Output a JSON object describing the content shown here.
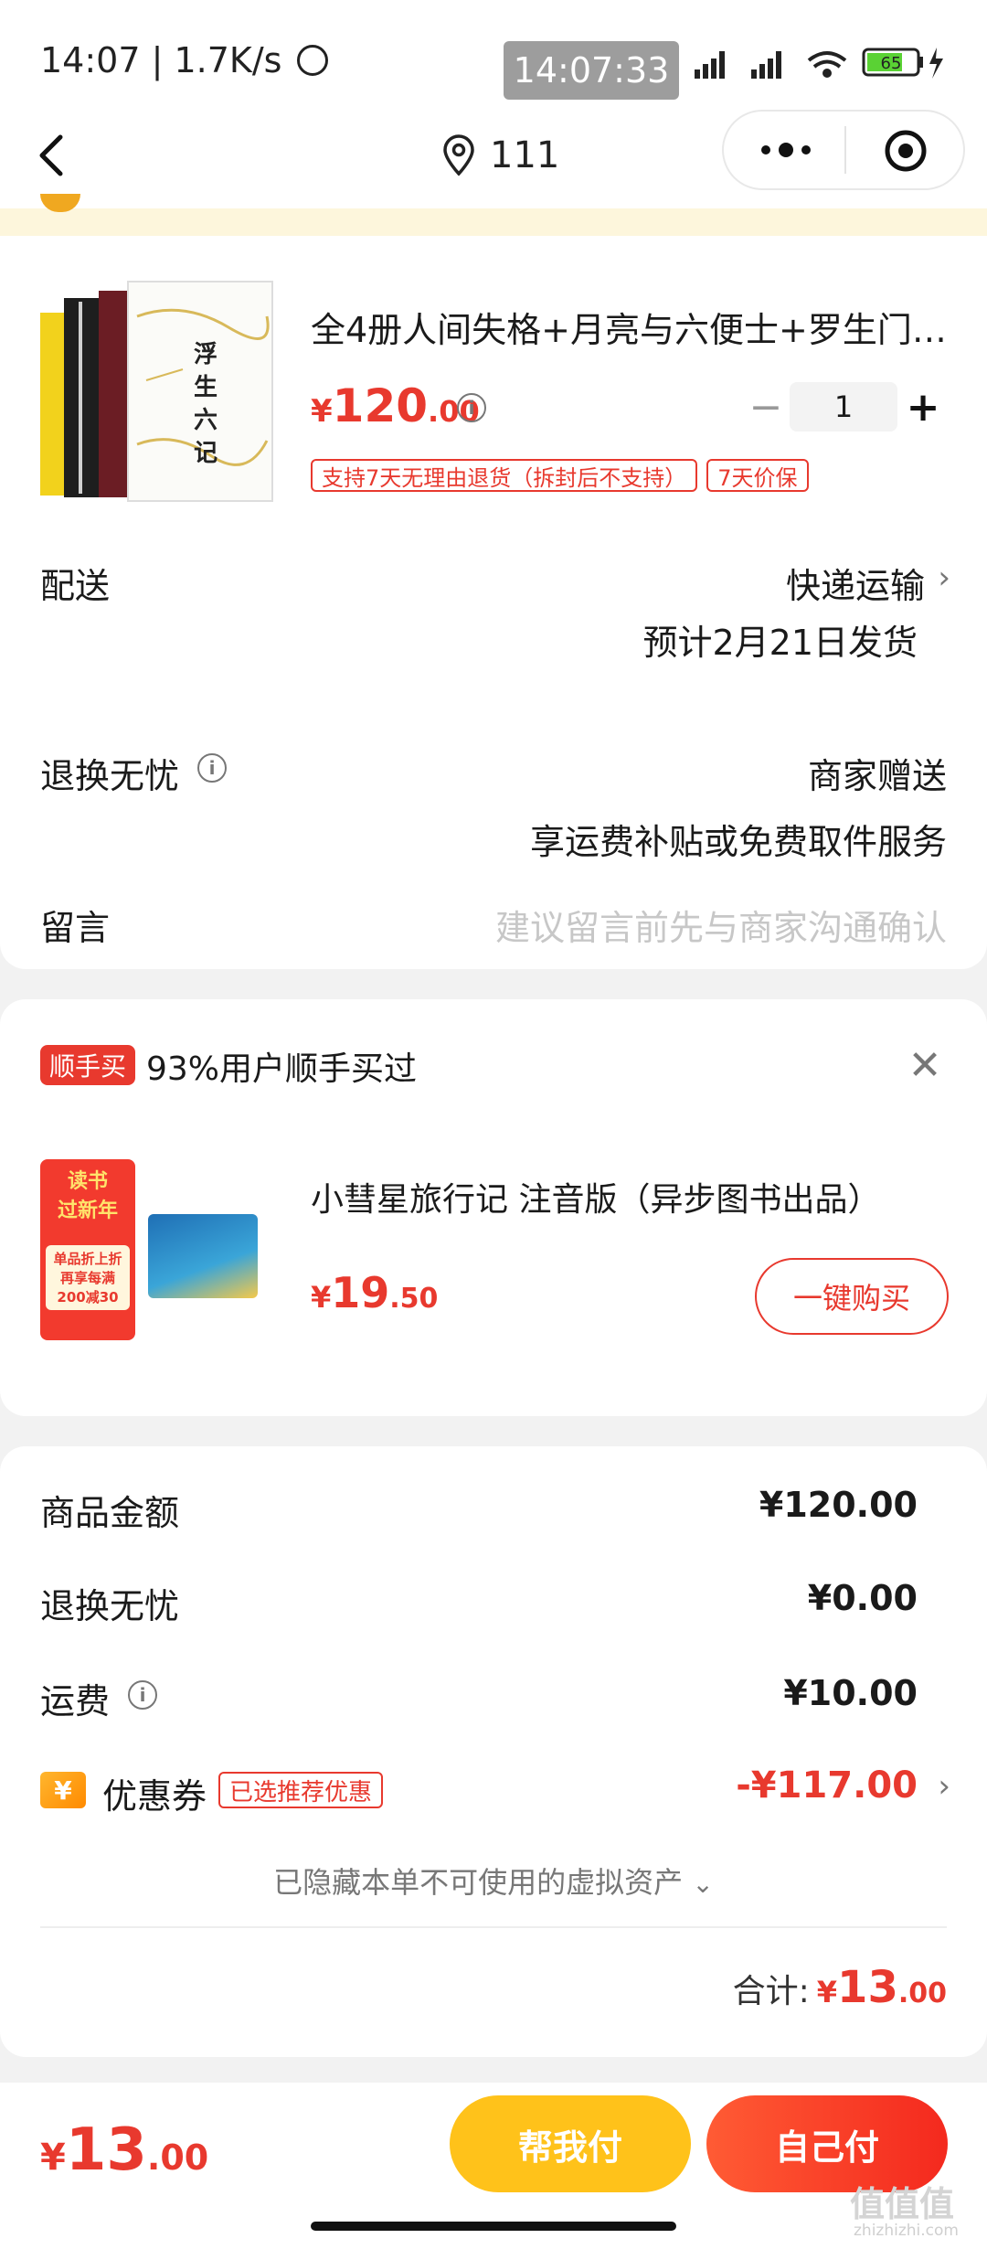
{
  "status_bar": {
    "time": "14:07",
    "speed": "1.7K/s",
    "clock_pill": "14:07:33",
    "battery": "65"
  },
  "nav": {
    "title": "111",
    "icons": [
      "back-icon",
      "location-icon",
      "more-icon",
      "target-icon"
    ]
  },
  "product": {
    "title": "全4册人间失格+月亮与六便士+罗生门+...",
    "price_symbol": "¥",
    "price_int": "120",
    "price_dec": ".00",
    "quantity": "1",
    "minus": "−",
    "plus": "+",
    "tags": [
      "支持7天无理由退货（拆封后不支持）",
      "7天价保"
    ],
    "cover_title": "浮生六记"
  },
  "delivery": {
    "label": "配送",
    "method": "快递运输",
    "estimate": "预计2月21日发货"
  },
  "return_service": {
    "label": "退换无忧",
    "value": "商家赠送",
    "desc": "享运费补贴或免费取件服务"
  },
  "message": {
    "label": "留言",
    "placeholder": "建议留言前先与商家沟通确认"
  },
  "recommend": {
    "badge": "顺手买",
    "text": "93%用户顺手买过",
    "item_title": "小彗星旅行记 注音版（异步图书出品）",
    "price_symbol": "¥",
    "price_int": "19",
    "price_dec": ".50",
    "buy_label": "一键购买",
    "promo": {
      "line1": "读书",
      "line2": "过新年",
      "line3": "单品折上折",
      "line4": "再享每满",
      "line5": "200减30"
    }
  },
  "summary": {
    "rows": [
      {
        "label": "商品金额",
        "value": "¥120.00"
      },
      {
        "label": "退换无忧",
        "value": "¥0.00"
      },
      {
        "label": "运费",
        "value": "¥10.00"
      }
    ],
    "coupon": {
      "label": "优惠券",
      "tag": "已选推荐优惠",
      "value": "-¥117.00",
      "icon_glyph": "¥"
    },
    "hidden_note": "已隐藏本单不可使用的虚拟资产",
    "total_label": "合计:",
    "total_symbol": "¥",
    "total_int": "13",
    "total_dec": ".00"
  },
  "bottom": {
    "price_symbol": "¥",
    "price_int": "13",
    "price_dec": ".00",
    "help_pay": "帮我付",
    "self_pay": "自己付"
  },
  "watermark": {
    "main": "值值值",
    "sub": "zhizhizhi.com"
  },
  "colors": {
    "accent_red": "#e8392e",
    "help_yellow": "#ffc21a"
  }
}
